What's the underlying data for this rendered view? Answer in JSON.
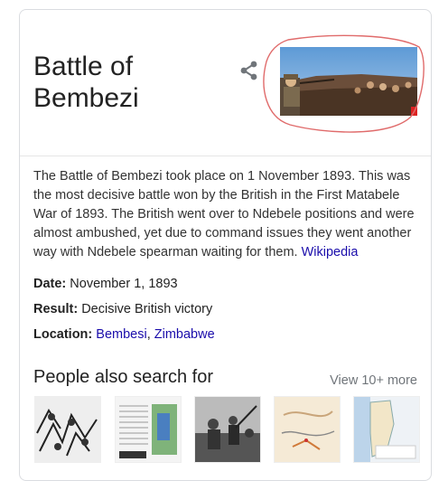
{
  "panel": {
    "title": "Battle of Bembezi",
    "share_icon": "share-icon",
    "description": "The Battle of Bembezi took place on 1 November 1893. This was the most decisive battle won by the British in the First Matabele War of 1893. The British went over to Ndebele positions and were almost ambushed, yet due to command issues they went another way with Ndebele spearman waiting for them.",
    "source_link": "Wikipedia",
    "annotation_color": "#e06b6b"
  },
  "facts": {
    "date_label": "Date:",
    "date_value": "November 1, 1893",
    "result_label": "Result:",
    "result_value": "Decisive British victory",
    "location_label": "Location:",
    "location_link_1": "Bembesi",
    "location_sep": ", ",
    "location_link_2": "Zimbabwe"
  },
  "people_also_search": {
    "heading": "People also search for",
    "more_link": "View 10+ more",
    "items": [
      {
        "kind": "engraving"
      },
      {
        "kind": "book-cover"
      },
      {
        "kind": "photo"
      },
      {
        "kind": "map"
      },
      {
        "kind": "map"
      }
    ]
  }
}
